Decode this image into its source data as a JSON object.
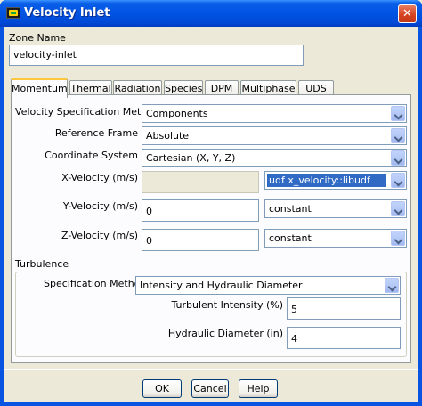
{
  "window": {
    "title": "Velocity Inlet",
    "close_glyph": "✕"
  },
  "zone": {
    "label": "Zone Name",
    "value": "velocity-inlet"
  },
  "tabs": [
    {
      "label": "Momentum",
      "active": true
    },
    {
      "label": "Thermal"
    },
    {
      "label": "Radiation"
    },
    {
      "label": "Species"
    },
    {
      "label": "DPM"
    },
    {
      "label": "Multiphase"
    },
    {
      "label": "UDS"
    }
  ],
  "momentum": {
    "spec_method": {
      "label": "Velocity Specification Method",
      "value": "Components"
    },
    "reference_frame": {
      "label": "Reference Frame",
      "value": "Absolute"
    },
    "coordinate_system": {
      "label": "Coordinate System",
      "value": "Cartesian (X, Y, Z)"
    },
    "x_velocity": {
      "label": "X-Velocity (m/s)",
      "value": "",
      "profile": "udf x_velocity::libudf"
    },
    "y_velocity": {
      "label": "Y-Velocity (m/s)",
      "value": "0",
      "profile": "constant"
    },
    "z_velocity": {
      "label": "Z-Velocity (m/s)",
      "value": "0",
      "profile": "constant"
    }
  },
  "turbulence": {
    "title": "Turbulence",
    "spec_method": {
      "label": "Specification Method",
      "value": "Intensity and Hydraulic Diameter"
    },
    "intensity": {
      "label": "Turbulent Intensity (%)",
      "value": "5"
    },
    "hydraulic_diameter": {
      "label": "Hydraulic Diameter (in)",
      "value": "4"
    }
  },
  "buttons": {
    "ok": "OK",
    "cancel": "Cancel",
    "help": "Help"
  },
  "colors": {
    "title_bar": "#0054e3",
    "dialog_bg": "#ece9d8",
    "selection": "#316ac5",
    "close_button": "#d5431f"
  }
}
